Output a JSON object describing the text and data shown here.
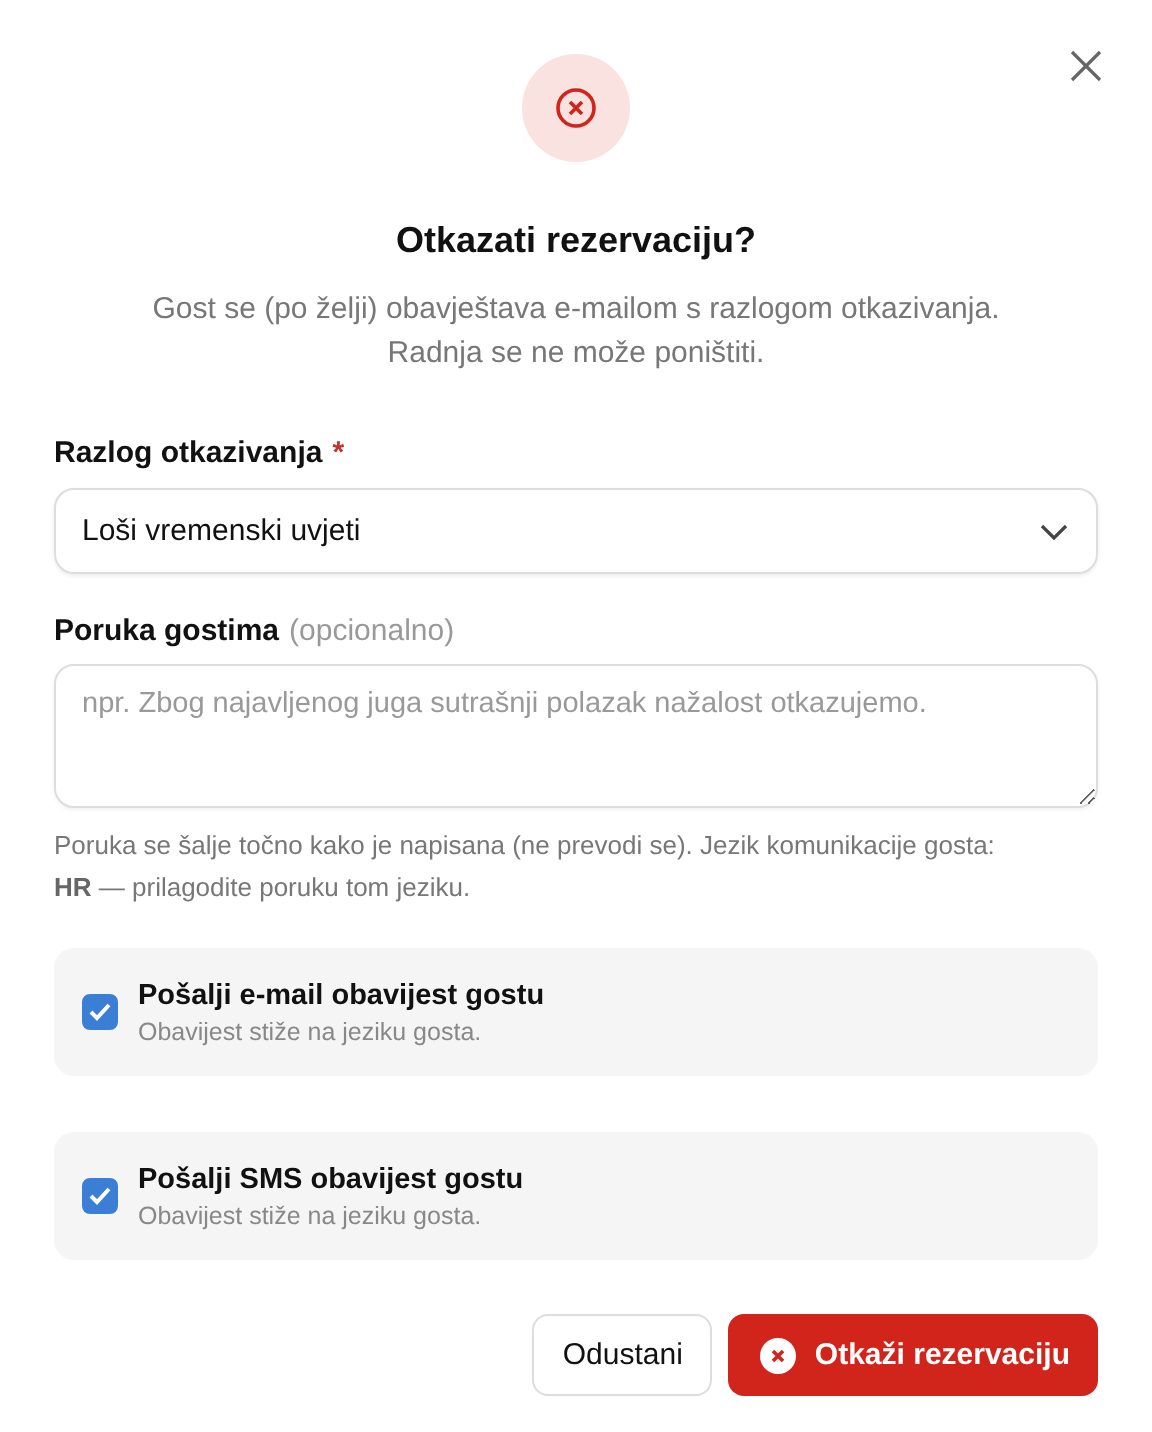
{
  "dialog": {
    "title": "Otkazati rezervaciju?",
    "description": [
      "Gost se (po želji) obavještava e-mailom s razlogom otkazivanja.",
      "Radnja se ne može poništiti."
    ]
  },
  "reason": {
    "label": "Razlog otkazivanja",
    "required_mark": "*",
    "value": "Loši vremenski uvjeti"
  },
  "message": {
    "label": "Poruka gostima",
    "label_hint": "(opcionalno)",
    "placeholder": "npr. Zbog najavljenog juga sutrašnji polazak nažalost otkazujemo.",
    "help": "Poruka se šalje točno kako je napisana (ne prevodi se). Jezik komunikacije gosta: **HR** — prilagodite poruku tom jeziku."
  },
  "options": [
    {
      "label": "Pošalji e-mail obavijest gostu",
      "description": "Obavijest stiže na jeziku gosta.",
      "checked": true
    },
    {
      "label": "Pošalji SMS obavijest gostu",
      "description": "Obavijest stiže na jeziku gosta.",
      "checked": true
    }
  ],
  "buttons": [
    {
      "label": "Odustani",
      "kind": "secondary"
    },
    {
      "label": "Otkaži rezervaciju",
      "kind": "danger"
    }
  ]
}
